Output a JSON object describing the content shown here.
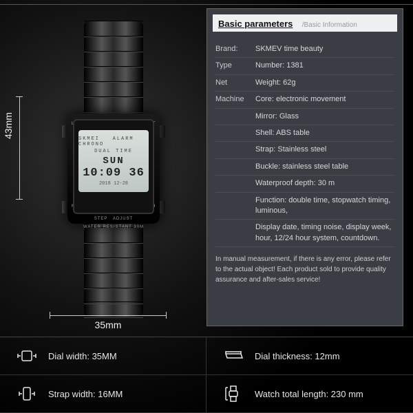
{
  "panel": {
    "title": "Basic parameters",
    "subtitle": "/Basic Information",
    "rows": [
      {
        "k": "Brand:",
        "v": "SKMEV time beauty"
      },
      {
        "k": "Type",
        "v": "Number: 1381"
      },
      {
        "k": "Net",
        "v": "Weight: 62g"
      },
      {
        "k": "Machine",
        "v": "Core: electronic movement"
      },
      {
        "k": "",
        "v": "Mirror: Glass"
      },
      {
        "k": "",
        "v": "Shell: ABS table"
      },
      {
        "k": "",
        "v": "Strap: Stainless steel"
      },
      {
        "k": "",
        "v": "Buckle: stainless steel table"
      },
      {
        "k": "",
        "v": "Waterproof depth: 30 m"
      },
      {
        "k": "",
        "v": "Function: double time, stopwatch timing, luminous,"
      },
      {
        "k": "",
        "v": "Display date, timing noise, display week, hour, 12/24 hour system, countdown."
      }
    ],
    "note": "In manual measurement, if there is any error, please refer to the actual object! Each product sold to provide quality assurance and after-sales service!"
  },
  "watch": {
    "brand": "SKMEI",
    "top_label": "ALARM CHRONO",
    "dual": "DUAL TIME",
    "day": "SUN",
    "time": "10:09 36",
    "date": "2018  12-28",
    "wr": "WATER RESISTANT 30M",
    "btn_tl": "LIGHT",
    "btn_tr": "SET",
    "btn_bl": "MODE",
    "btn_br": "12/24H",
    "bottom_l": "STEP",
    "bottom_r": "ADJUST"
  },
  "dims": {
    "height": "43mm",
    "width": "35mm"
  },
  "metrics": {
    "dial_width": "Dial width: 35MM",
    "dial_thickness": "Dial thickness: 12mm",
    "strap_width": "Strap width: 16MM",
    "total_length": "Watch total length: 230 mm"
  }
}
